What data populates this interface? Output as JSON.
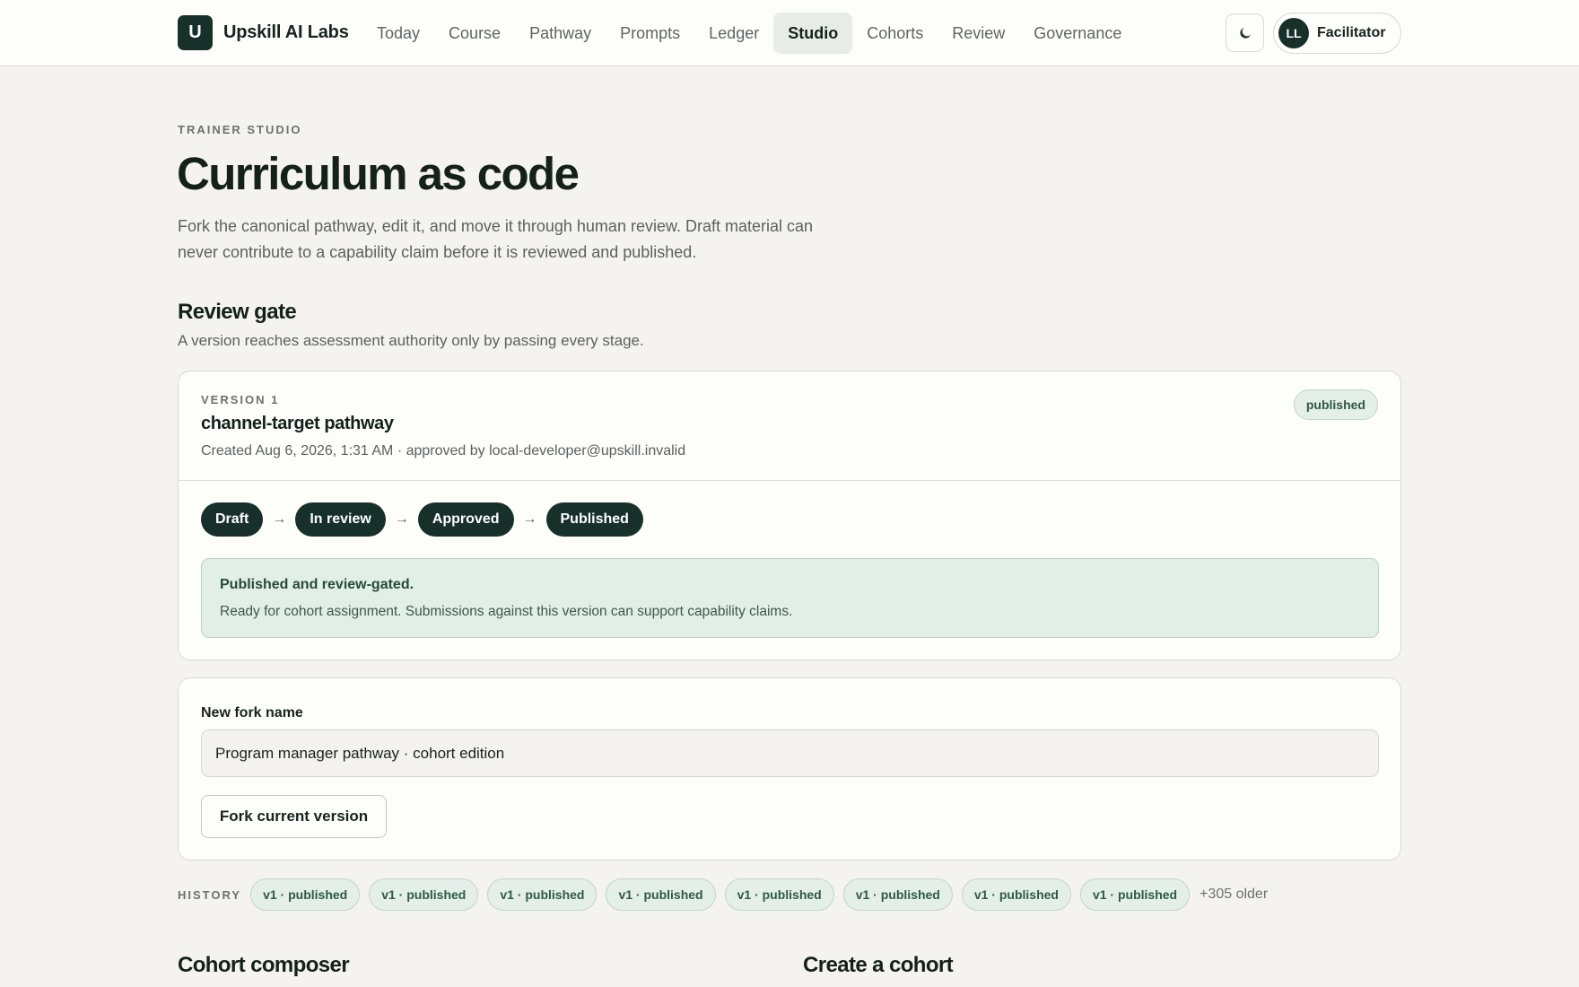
{
  "brand": {
    "logo_letter": "U",
    "name": "Upskill AI Labs"
  },
  "nav": [
    {
      "label": "Today"
    },
    {
      "label": "Course"
    },
    {
      "label": "Pathway"
    },
    {
      "label": "Prompts"
    },
    {
      "label": "Ledger"
    },
    {
      "label": "Studio",
      "active": true
    },
    {
      "label": "Cohorts"
    },
    {
      "label": "Review"
    },
    {
      "label": "Governance"
    }
  ],
  "user": {
    "initials": "LL",
    "role": "Facilitator"
  },
  "icons": {
    "theme_toggle": "moon-icon",
    "stage_separator": "arrow-right-icon"
  },
  "header": {
    "eyebrow": "TRAINER STUDIO",
    "title": "Curriculum as code",
    "description": "Fork the canonical pathway, edit it, and move it through human review. Draft material can never contribute to a capability claim before it is reviewed and published."
  },
  "review_gate": {
    "title": "Review gate",
    "subtitle": "A version reaches assessment authority only by passing every stage.",
    "version_label": "VERSION 1",
    "version_name": "channel-target pathway",
    "meta": "Created Aug 6, 2026, 1:31 AM · approved by local-developer@upskill.invalid",
    "status": "published",
    "stages": [
      "Draft",
      "In review",
      "Approved",
      "Published"
    ],
    "callout_title": "Published and review-gated.",
    "callout_body": "Ready for cohort assignment. Submissions against this version can support capability claims."
  },
  "fork": {
    "label": "New fork name",
    "value": "Program manager pathway · cohort edition",
    "button": "Fork current version"
  },
  "history": {
    "label": "HISTORY",
    "items": [
      "v1 · published",
      "v1 · published",
      "v1 · published",
      "v1 · published",
      "v1 · published",
      "v1 · published",
      "v1 · published",
      "v1 · published"
    ],
    "more": "+305 older"
  },
  "sections": {
    "cohort_composer": "Cohort composer",
    "create_cohort": "Create a cohort"
  },
  "colors": {
    "brand_dark": "#17302a",
    "page_bg": "#f5f3ef",
    "success_bg": "#e2efe7",
    "success_text": "#25493a"
  }
}
